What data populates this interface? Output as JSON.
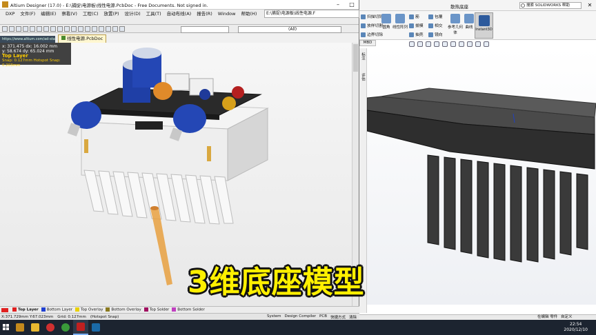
{
  "altium": {
    "title": "Altium Designer (17.0) - E:\\捕捉\\电源板\\线性电源.PcbDoc - Free Documents. Not signed in.",
    "path": "E:\\捕捉\\电源板\\线性电源.F",
    "menu": [
      "DXP",
      "文件(F)",
      "编辑(E)",
      "察看(V)",
      "工程(C)",
      "放置(P)",
      "设计(D)",
      "工具(T)",
      "自动布线(A)",
      "报告(R)",
      "Window",
      "帮助(H)"
    ],
    "combo_right": "(All)",
    "doc_tab": "线性电源.PcbDoc",
    "url": "https://www.altium.com/ad-star",
    "hud": {
      "line1": "x: 371.475   dx: 16.002  mm",
      "line2": "y: 58.674    dy: 65.024  mm",
      "layer": "Top Layer",
      "snap": "Snap: 0.127mm Hotspot Snap: 0.203mm"
    },
    "layers": [
      {
        "label": "Top Layer",
        "color": "#e02020",
        "active": true
      },
      {
        "label": "Bottom Layer",
        "color": "#2040d0",
        "active": false
      },
      {
        "label": "Top Overlay",
        "color": "#e8d000",
        "active": false
      },
      {
        "label": "Bottom Overlay",
        "color": "#8a7a20",
        "active": false
      },
      {
        "label": "Top Solder",
        "color": "#a01060",
        "active": false
      },
      {
        "label": "Bottom Solder",
        "color": "#c040c0",
        "active": false
      }
    ],
    "status": {
      "coords": "X:371.729mm Y:67.023mm",
      "grid": "Grid: 0.127mm",
      "hotspot": "(Hotspot Snap)",
      "right": [
        "System",
        "Design Compiler",
        "PCB",
        "快捷方式",
        "清除"
      ]
    }
  },
  "solidworks": {
    "title": "散热底座",
    "search_placeholder": "搜索 SOLIDWORKS 帮助",
    "ribbon": {
      "col1": [
        "扫描切除",
        "放样切割",
        "边界切除"
      ],
      "big": [
        "圆角",
        "线性阵列"
      ],
      "col2": [
        "筋",
        "拔模",
        "抽壳"
      ],
      "col3": [
        "包覆",
        "相交",
        "镜向"
      ],
      "big2": [
        "参考几何体",
        "曲线"
      ],
      "highlight": "Instant3D"
    },
    "mbd_tab": "MBD",
    "side_labels": [
      "标注",
      "评估"
    ],
    "status_left": "在编辑 零件",
    "status_right": "自定义"
  },
  "taskbar": {
    "time": "22:54",
    "date": "2020/12/10"
  },
  "caption": "3维底座模型",
  "colors": {
    "title_bg": "#ffffff",
    "heatsink_dark": "#3a3a3a",
    "caption": "#fff000"
  }
}
